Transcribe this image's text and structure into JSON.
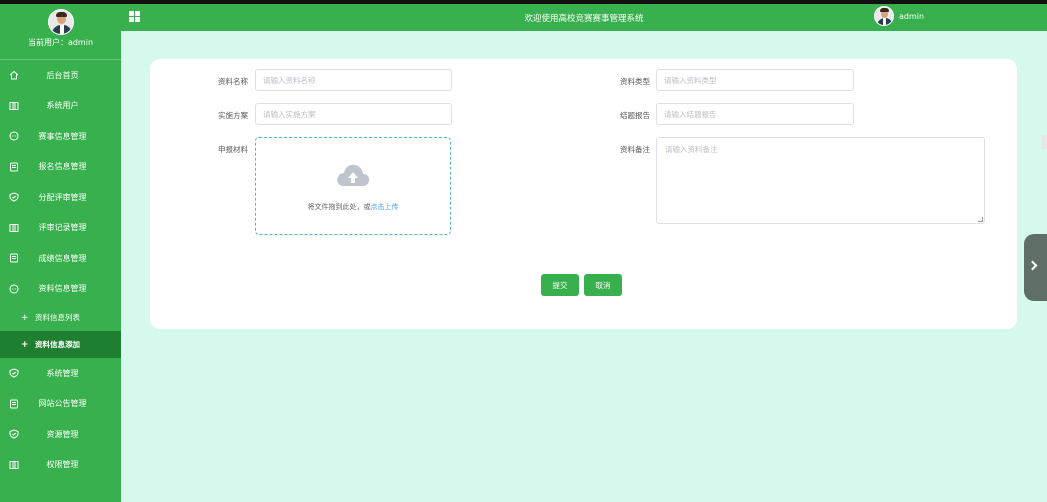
{
  "header": {
    "title": "欢迎使用高校竞赛赛事管理系统",
    "username": "admin"
  },
  "sidebar": {
    "current_user_label": "当前用户：",
    "current_user": "admin",
    "items": [
      {
        "label": "后台首页",
        "icon": "home-icon"
      },
      {
        "label": "系统用户",
        "icon": "columns-icon"
      },
      {
        "label": "赛事信息管理",
        "icon": "chat-icon"
      },
      {
        "label": "报名信息管理",
        "icon": "document-icon"
      },
      {
        "label": "分配评审管理",
        "icon": "shield-icon"
      },
      {
        "label": "评审记录管理",
        "icon": "columns-icon"
      },
      {
        "label": "成绩信息管理",
        "icon": "document-icon"
      },
      {
        "label": "资料信息管理",
        "icon": "chat-icon"
      }
    ],
    "sub_items": [
      {
        "label": "资料信息列表"
      },
      {
        "label": "资料信息添加",
        "active": true
      }
    ],
    "items_after": [
      {
        "label": "系统管理",
        "icon": "shield-icon"
      },
      {
        "label": "网站公告管理",
        "icon": "document-icon"
      },
      {
        "label": "资源管理",
        "icon": "shield-icon"
      },
      {
        "label": "权限管理",
        "icon": "columns-icon"
      }
    ]
  },
  "form": {
    "name_label": "资料名称",
    "name_placeholder": "请输入资料名称",
    "type_label": "资料类型",
    "type_placeholder": "请输入资料类型",
    "plan_label": "实施方案",
    "plan_placeholder": "请输入实施方案",
    "report_label": "结题报告",
    "report_placeholder": "请输入结题报告",
    "material_label": "申报材料",
    "upload_text": "将文件拖到此处，或",
    "upload_link": "点击上传",
    "remark_label": "资料备注",
    "remark_placeholder": "请输入资料备注",
    "submit": "提交",
    "cancel": "取消"
  },
  "colors": {
    "accent": "#38b04d",
    "background": "#d5f9ec",
    "active_item": "#1f7f30"
  }
}
